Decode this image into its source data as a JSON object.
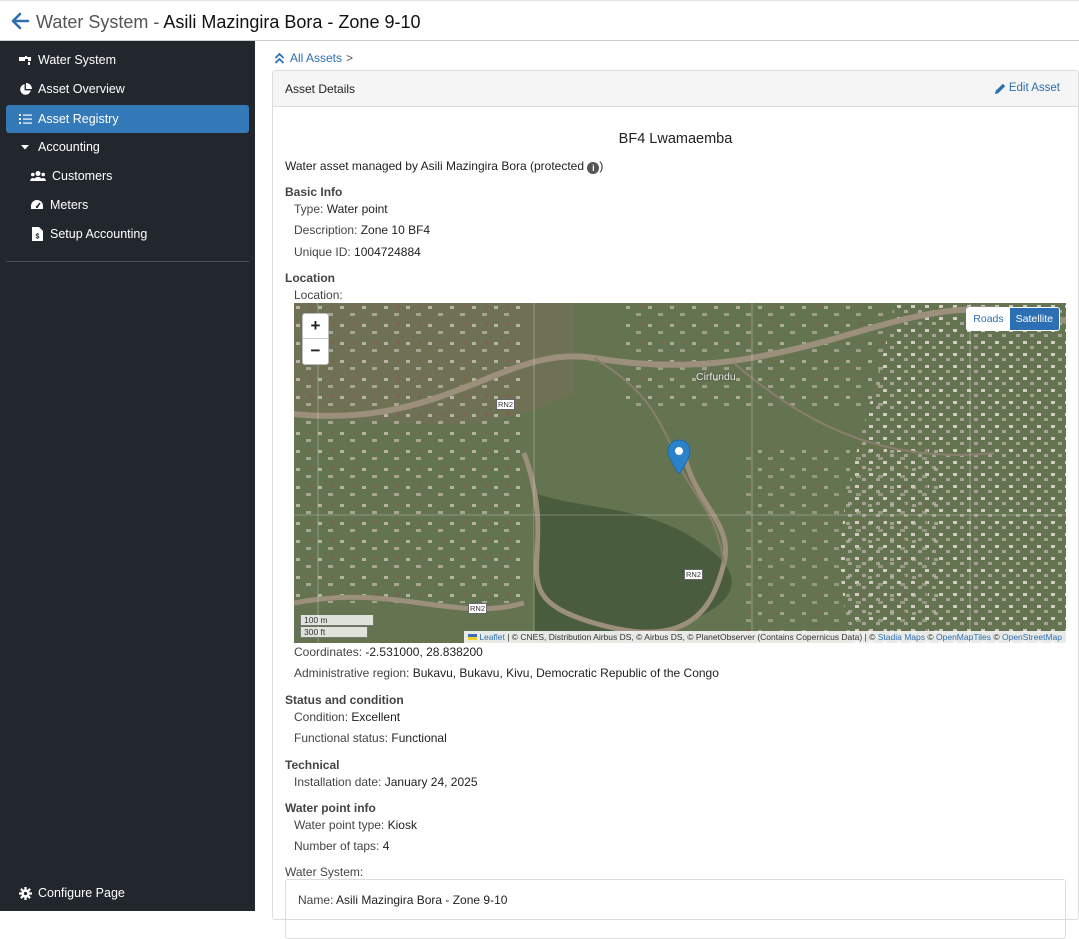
{
  "header": {
    "prefix": "Water System",
    "separator": " - ",
    "name": "Asili Mazingira Bora - Zone 9-10"
  },
  "sidebar": {
    "items": [
      {
        "label": "Water System",
        "icon": "faucet-icon"
      },
      {
        "label": "Asset Overview",
        "icon": "pie-chart-icon"
      },
      {
        "label": "Asset Registry",
        "icon": "list-icon",
        "active": true
      },
      {
        "label": "Accounting",
        "icon": "caret-down-icon"
      },
      {
        "label": "Customers",
        "icon": "users-icon"
      },
      {
        "label": "Meters",
        "icon": "gauge-icon"
      },
      {
        "label": "Setup Accounting",
        "icon": "file-dollar-icon"
      }
    ],
    "footer": {
      "label": "Configure Page",
      "icon": "gear-icon"
    }
  },
  "breadcrumb": {
    "label": "All Assets",
    "separator": ">"
  },
  "panel": {
    "heading": "Asset Details",
    "edit_label": "Edit Asset"
  },
  "asset": {
    "name": "BF4 Lwamaemba",
    "managed_text": "Water asset managed by Asili Mazingira Bora (protected",
    "managed_close": ")",
    "basic_info": {
      "title": "Basic Info",
      "type_label": "Type:",
      "type": "Water point",
      "description_label": "Description:",
      "description": "Zone 10 BF4",
      "unique_id_label": "Unique ID:",
      "unique_id": "1004724884"
    },
    "location": {
      "title": "Location",
      "location_label": "Location:",
      "coordinates_label": "Coordinates:",
      "coordinates": "-2.531000, 28.838200",
      "region_label": "Administrative region:",
      "region": "Bukavu, Bukavu, Kivu, Democratic Republic of the Congo"
    },
    "status": {
      "title": "Status and condition",
      "condition_label": "Condition:",
      "condition": "Excellent",
      "functional_label": "Functional status:",
      "functional": "Functional"
    },
    "technical": {
      "title": "Technical",
      "install_label": "Installation date:",
      "install": "January 24, 2025"
    },
    "water_point": {
      "title": "Water point info",
      "wp_type_label": "Water point type:",
      "wp_type": "Kiosk",
      "taps_label": "Number of taps:",
      "taps": "4"
    },
    "water_system": {
      "title": "Water System:",
      "name_label": "Name:",
      "name": "Asili Mazingira Bora - Zone 9-10"
    }
  },
  "map": {
    "zoom_in": "+",
    "zoom_out": "−",
    "roads_label": "Roads",
    "satellite_label": "Satellite",
    "scale_m": "100 m",
    "scale_ft": "300 ft",
    "place_label": "Cirfundu",
    "road_labels": [
      "RN2",
      "RN2",
      "RN2"
    ],
    "attrib_leaflet": "Leaflet",
    "attrib_text": " | © CNES, Distribution Airbus DS, © Airbus DS, © PlanetObserver (Contains Copernicus Data) | © ",
    "attrib_stadia": "Stadia Maps",
    "attrib_copy": " © ",
    "attrib_omt": "OpenMapTiles",
    "attrib_osm": "OpenStreetMap",
    "colors": {
      "accent": "#2c6fb3",
      "marker": "#2b82cb"
    }
  }
}
